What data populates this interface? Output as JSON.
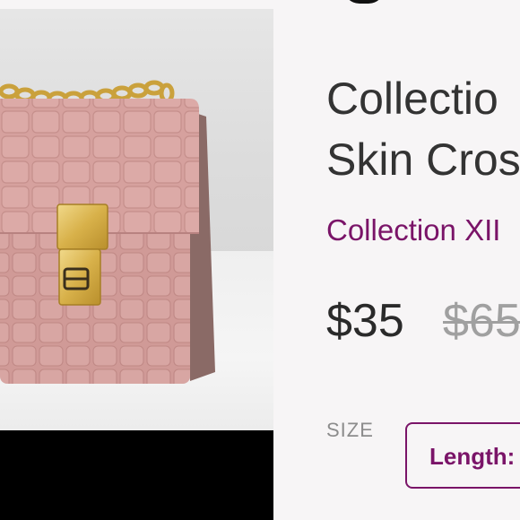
{
  "product": {
    "title_line1": "Collectio",
    "title_line2": "Skin Cros",
    "brand": "Collection XII",
    "price": "$35",
    "original_price": "$65"
  },
  "size": {
    "label": "SIZE",
    "selected_option": "Length:"
  },
  "icons": {
    "top_partial_icon": "partial-circle-icon"
  },
  "colors": {
    "brand_accent": "#7a1468",
    "price_text": "#2a2a2a",
    "original_price_text": "#a0a0a0",
    "background": "#f7f5f6",
    "bag_pink": "#d9a7a4",
    "clasp_gold": "#d8b14a"
  }
}
